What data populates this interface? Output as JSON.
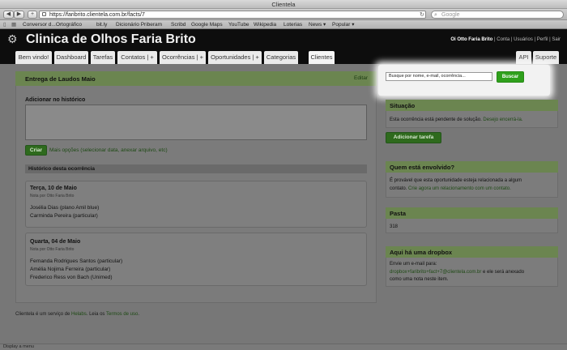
{
  "window": {
    "title": "Clientela"
  },
  "browser": {
    "url": "https://faribrito.clientela.com.br/facts/7",
    "search_placeholder": "Google",
    "bookmarks": [
      "Conversor d...Ortográfico",
      "bit.ly",
      "Dicionário Priberam",
      "Scribd",
      "Google Maps",
      "YouTube",
      "Wikipedia",
      "Loterias",
      "News ▾",
      "Popular ▾"
    ]
  },
  "app": {
    "title": "Clinica de Olhos Faria Brito",
    "user_greeting": "Oi Otto Faria Brito",
    "user_links": [
      "Conta",
      "Usuários",
      "Perfil",
      "Sair"
    ],
    "tabs": [
      "Bem vindo!",
      "Dashboard",
      "Tarefas",
      "Contatos | +",
      "Ocorrências | +",
      "Oportunidades | +",
      "Categorias",
      "Clientes"
    ],
    "right_tabs": [
      "API",
      "Suporte"
    ]
  },
  "main": {
    "title": "Entrega de Laudos Maio",
    "edit_link": "Editar",
    "add_label": "Adicionar no histórico",
    "create_button": "Criar",
    "more_options": "Mais opções (selecionar data, anexar arquivo, etc)",
    "history_title": "Histórico desta ocorrência",
    "entries": [
      {
        "date": "Terça, 10 de Maio",
        "note": "Nota por Otto Faria Brito",
        "lines": [
          "Josélia Dias (plano Amil blue)",
          "Carminda Pereira (particular)"
        ]
      },
      {
        "date": "Quarta, 04 de Maio",
        "note": "Nota por Otto Faria Brito",
        "lines": [
          "Fernanda Rodrigues Santos (particular)",
          "Amélia Nojima Ferreira (particular)",
          "Frederico Ress von Bach (Unimed)"
        ]
      }
    ]
  },
  "search": {
    "placeholder": "Busque por nome, e-mail, ocorrência...",
    "button": "Buscar"
  },
  "sidebar": {
    "situacao": {
      "title": "Situação",
      "text": "Esta ocorrência está pendente de solução.",
      "link": "Desejo encerrá-la.",
      "button": "Adicionar tarefa"
    },
    "envolvido": {
      "title": "Quem está envolvido?",
      "text1": "É provável que esta oportunidade esteja relacionada a algum",
      "text2": "contato.",
      "link": "Crie agora um relacionamento com um contato."
    },
    "pasta": {
      "title": "Pasta",
      "value": "318"
    },
    "dropbox": {
      "title": "Aqui há uma dropbox",
      "text1": "Envie um e-mail para:",
      "email": "dropbox+faribrito+fact+7@clientela.com.br",
      "text2": "e ele será anexado",
      "text3": "como uma nota neste item."
    }
  },
  "footer": {
    "prefix": "Clientela é um serviço de",
    "company": "Helabs",
    "middle": ". Leia os",
    "terms": "Termos de uso",
    "suffix": "."
  },
  "statusbar": {
    "text": "Display a menu"
  }
}
